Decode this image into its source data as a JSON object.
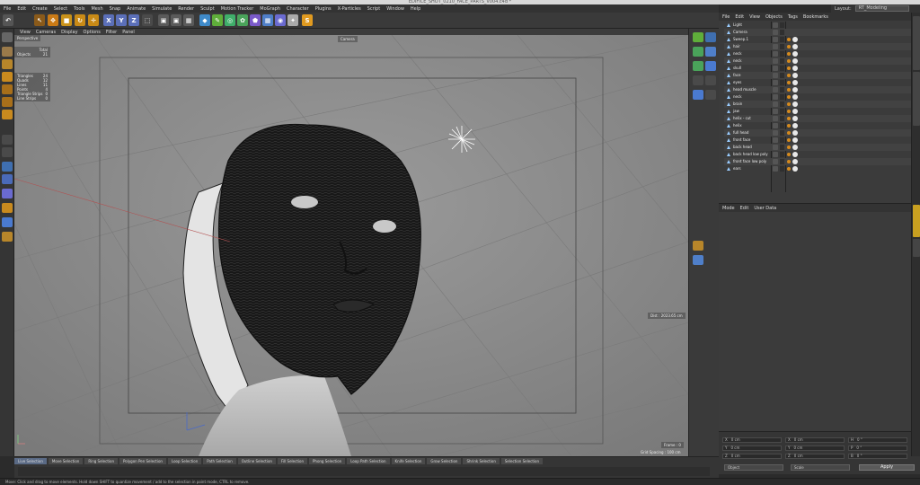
{
  "window": {
    "title": "EDIFICE_SHOT_0210_FACE_PARTS_V004.c4d *"
  },
  "menu": [
    "File",
    "Edit",
    "Create",
    "Select",
    "Tools",
    "Mesh",
    "Snap",
    "Animate",
    "Simulate",
    "Render",
    "Sculpt",
    "Motion Tracker",
    "MoGraph",
    "Character",
    "Plugins",
    "X-Particles",
    "Script",
    "Window",
    "Help"
  ],
  "layout": {
    "label": "Layout:",
    "value": "RT_Modeling"
  },
  "toolbar": {
    "axis_buttons": [
      "X",
      "Y",
      "Z"
    ]
  },
  "viewport": {
    "menu": [
      "View",
      "Cameras",
      "Display",
      "Options",
      "Filter",
      "Panel"
    ],
    "view_name": "Perspective",
    "camera_label": "Camera",
    "hud_stats": {
      "header": "Total",
      "objects_label": "Objects",
      "objects_value": "21",
      "rows": [
        {
          "label": "Triangles",
          "value": "24"
        },
        {
          "label": "Quads",
          "value": "12"
        },
        {
          "label": "Lines",
          "value": "11"
        },
        {
          "label": "Points",
          "value": "4"
        },
        {
          "label": "Triangle Strips",
          "value": "0"
        },
        {
          "label": "Line Strips",
          "value": "0"
        }
      ]
    },
    "dist": "Dist : 2023.65 cm",
    "frame": "Frame : 0",
    "grid_spacing": "Grid Spacing : 100 cm",
    "axis_label": "A"
  },
  "object_manager": {
    "menu": [
      "File",
      "Edit",
      "View",
      "Objects",
      "Tags",
      "Bookmarks"
    ],
    "objects": [
      "Light",
      "Camera",
      "Sweep.1",
      "hair",
      "neck",
      "neck",
      "skull",
      "face",
      "eyes",
      "head muscle",
      "neck",
      "brain",
      "jaw",
      "helix - cut",
      "helix",
      "full head",
      "front face",
      "back head",
      "back head low poly",
      "front face low poly",
      "ears"
    ]
  },
  "attributes_manager": {
    "menu": [
      "Mode",
      "Edit",
      "User Data"
    ]
  },
  "coordinates": {
    "rows": [
      [
        "X",
        "0 cm",
        "X",
        "0 cm",
        "H",
        "0 °"
      ],
      [
        "Y",
        "0 cm",
        "Y",
        "0 cm",
        "P",
        "0 °"
      ],
      [
        "Z",
        "0 cm",
        "Z",
        "0 cm",
        "B",
        "0 °"
      ]
    ],
    "mode_dropdown": "Object",
    "size_dropdown": "Scale",
    "apply_label": "Apply"
  },
  "timeline": {
    "tabs": [
      "Live Selection",
      "Move Selection",
      "Ring Selection",
      "Polygon Pen Selection",
      "Loop Selection",
      "Path Selection",
      "Outline Selection",
      "Fill Selection",
      "Phong Selection",
      "Loop Path Selection",
      "Knife Selection",
      "Grow Selection",
      "Shrink Selection",
      "Selection Selection"
    ]
  },
  "status": "Move: Click and drag to move elements. Hold down SHIFT to quantize movement / add to the selection in point mode, CTRL to remove."
}
